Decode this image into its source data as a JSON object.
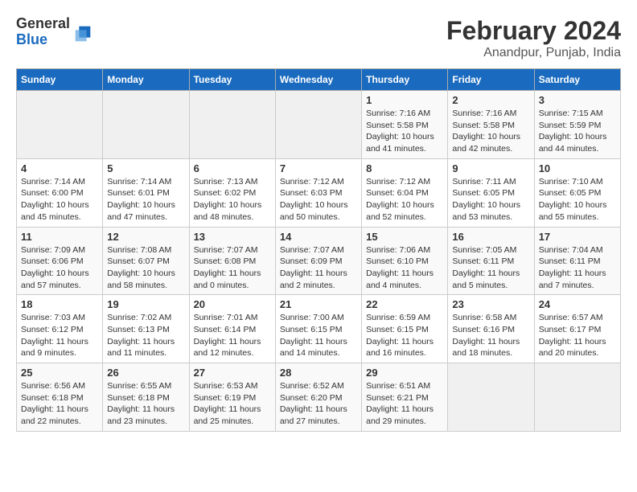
{
  "logo": {
    "general": "General",
    "blue": "Blue"
  },
  "title": "February 2024",
  "subtitle": "Anandpur, Punjab, India",
  "weekdays": [
    "Sunday",
    "Monday",
    "Tuesday",
    "Wednesday",
    "Thursday",
    "Friday",
    "Saturday"
  ],
  "weeks": [
    [
      {
        "day": "",
        "info": ""
      },
      {
        "day": "",
        "info": ""
      },
      {
        "day": "",
        "info": ""
      },
      {
        "day": "",
        "info": ""
      },
      {
        "day": "1",
        "info": "Sunrise: 7:16 AM\nSunset: 5:58 PM\nDaylight: 10 hours\nand 41 minutes."
      },
      {
        "day": "2",
        "info": "Sunrise: 7:16 AM\nSunset: 5:58 PM\nDaylight: 10 hours\nand 42 minutes."
      },
      {
        "day": "3",
        "info": "Sunrise: 7:15 AM\nSunset: 5:59 PM\nDaylight: 10 hours\nand 44 minutes."
      }
    ],
    [
      {
        "day": "4",
        "info": "Sunrise: 7:14 AM\nSunset: 6:00 PM\nDaylight: 10 hours\nand 45 minutes."
      },
      {
        "day": "5",
        "info": "Sunrise: 7:14 AM\nSunset: 6:01 PM\nDaylight: 10 hours\nand 47 minutes."
      },
      {
        "day": "6",
        "info": "Sunrise: 7:13 AM\nSunset: 6:02 PM\nDaylight: 10 hours\nand 48 minutes."
      },
      {
        "day": "7",
        "info": "Sunrise: 7:12 AM\nSunset: 6:03 PM\nDaylight: 10 hours\nand 50 minutes."
      },
      {
        "day": "8",
        "info": "Sunrise: 7:12 AM\nSunset: 6:04 PM\nDaylight: 10 hours\nand 52 minutes."
      },
      {
        "day": "9",
        "info": "Sunrise: 7:11 AM\nSunset: 6:05 PM\nDaylight: 10 hours\nand 53 minutes."
      },
      {
        "day": "10",
        "info": "Sunrise: 7:10 AM\nSunset: 6:05 PM\nDaylight: 10 hours\nand 55 minutes."
      }
    ],
    [
      {
        "day": "11",
        "info": "Sunrise: 7:09 AM\nSunset: 6:06 PM\nDaylight: 10 hours\nand 57 minutes."
      },
      {
        "day": "12",
        "info": "Sunrise: 7:08 AM\nSunset: 6:07 PM\nDaylight: 10 hours\nand 58 minutes."
      },
      {
        "day": "13",
        "info": "Sunrise: 7:07 AM\nSunset: 6:08 PM\nDaylight: 11 hours\nand 0 minutes."
      },
      {
        "day": "14",
        "info": "Sunrise: 7:07 AM\nSunset: 6:09 PM\nDaylight: 11 hours\nand 2 minutes."
      },
      {
        "day": "15",
        "info": "Sunrise: 7:06 AM\nSunset: 6:10 PM\nDaylight: 11 hours\nand 4 minutes."
      },
      {
        "day": "16",
        "info": "Sunrise: 7:05 AM\nSunset: 6:11 PM\nDaylight: 11 hours\nand 5 minutes."
      },
      {
        "day": "17",
        "info": "Sunrise: 7:04 AM\nSunset: 6:11 PM\nDaylight: 11 hours\nand 7 minutes."
      }
    ],
    [
      {
        "day": "18",
        "info": "Sunrise: 7:03 AM\nSunset: 6:12 PM\nDaylight: 11 hours\nand 9 minutes."
      },
      {
        "day": "19",
        "info": "Sunrise: 7:02 AM\nSunset: 6:13 PM\nDaylight: 11 hours\nand 11 minutes."
      },
      {
        "day": "20",
        "info": "Sunrise: 7:01 AM\nSunset: 6:14 PM\nDaylight: 11 hours\nand 12 minutes."
      },
      {
        "day": "21",
        "info": "Sunrise: 7:00 AM\nSunset: 6:15 PM\nDaylight: 11 hours\nand 14 minutes."
      },
      {
        "day": "22",
        "info": "Sunrise: 6:59 AM\nSunset: 6:15 PM\nDaylight: 11 hours\nand 16 minutes."
      },
      {
        "day": "23",
        "info": "Sunrise: 6:58 AM\nSunset: 6:16 PM\nDaylight: 11 hours\nand 18 minutes."
      },
      {
        "day": "24",
        "info": "Sunrise: 6:57 AM\nSunset: 6:17 PM\nDaylight: 11 hours\nand 20 minutes."
      }
    ],
    [
      {
        "day": "25",
        "info": "Sunrise: 6:56 AM\nSunset: 6:18 PM\nDaylight: 11 hours\nand 22 minutes."
      },
      {
        "day": "26",
        "info": "Sunrise: 6:55 AM\nSunset: 6:18 PM\nDaylight: 11 hours\nand 23 minutes."
      },
      {
        "day": "27",
        "info": "Sunrise: 6:53 AM\nSunset: 6:19 PM\nDaylight: 11 hours\nand 25 minutes."
      },
      {
        "day": "28",
        "info": "Sunrise: 6:52 AM\nSunset: 6:20 PM\nDaylight: 11 hours\nand 27 minutes."
      },
      {
        "day": "29",
        "info": "Sunrise: 6:51 AM\nSunset: 6:21 PM\nDaylight: 11 hours\nand 29 minutes."
      },
      {
        "day": "",
        "info": ""
      },
      {
        "day": "",
        "info": ""
      }
    ]
  ]
}
